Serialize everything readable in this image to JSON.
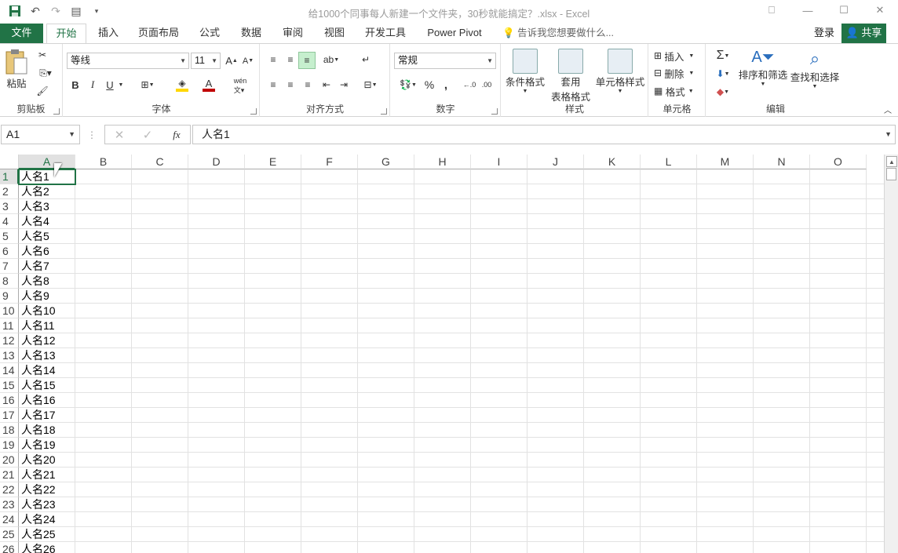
{
  "window": {
    "title": "给1000个同事每人新建一个文件夹，30秒就能搞定？.xlsx - Excel",
    "controls": [
      "⎕",
      "—",
      "☐",
      "✕"
    ]
  },
  "qat": {
    "save": "save-icon",
    "undo": "undo-icon",
    "redo": "redo-icon",
    "form": "form-icon"
  },
  "tabs": [
    "文件",
    "开始",
    "插入",
    "页面布局",
    "公式",
    "数据",
    "审阅",
    "视图",
    "开发工具",
    "Power Pivot"
  ],
  "tell_me": "告诉我您想要做什么...",
  "sign_in": "登录",
  "share": "共享",
  "ribbon": {
    "clipboard": {
      "paste": "粘贴",
      "label": "剪贴板"
    },
    "font": {
      "name": "等线",
      "size": "11",
      "label": "字体",
      "bold": "B",
      "italic": "I",
      "underline": "U"
    },
    "alignment": {
      "label": "对齐方式"
    },
    "number": {
      "format": "常规",
      "percent": "%",
      "comma": ",",
      "label": "数字"
    },
    "styles": {
      "conditional": "条件格式",
      "table_1": "套用",
      "table_2": "表格格式",
      "cell_styles": "单元格样式",
      "label": "样式"
    },
    "cells": {
      "insert": "插入",
      "delete": "删除",
      "format": "格式",
      "label": "单元格"
    },
    "editing": {
      "sort": "排序和筛选",
      "find": "查找和选择",
      "label": "编辑"
    }
  },
  "formula_bar": {
    "name_box": "A1",
    "fx": "fx",
    "content": "人名1"
  },
  "columns": [
    "A",
    "B",
    "C",
    "D",
    "E",
    "F",
    "G",
    "H",
    "I",
    "J",
    "K",
    "L",
    "M",
    "N",
    "O"
  ],
  "rows": [
    "1",
    "2",
    "3",
    "4",
    "5",
    "6",
    "7",
    "8",
    "9",
    "10",
    "11",
    "12",
    "13",
    "14",
    "15",
    "16",
    "17",
    "18",
    "19",
    "20",
    "21",
    "22",
    "23",
    "24",
    "25",
    "26"
  ],
  "cells_a": [
    "人名1",
    "人名2",
    "人名3",
    "人名4",
    "人名5",
    "人名6",
    "人名7",
    "人名8",
    "人名9",
    "人名10",
    "人名11",
    "人名12",
    "人名13",
    "人名14",
    "人名15",
    "人名16",
    "人名17",
    "人名18",
    "人名19",
    "人名20",
    "人名21",
    "人名22",
    "人名23",
    "人名24",
    "人名25",
    "人名26"
  ],
  "colors": {
    "accent": "#217346"
  }
}
